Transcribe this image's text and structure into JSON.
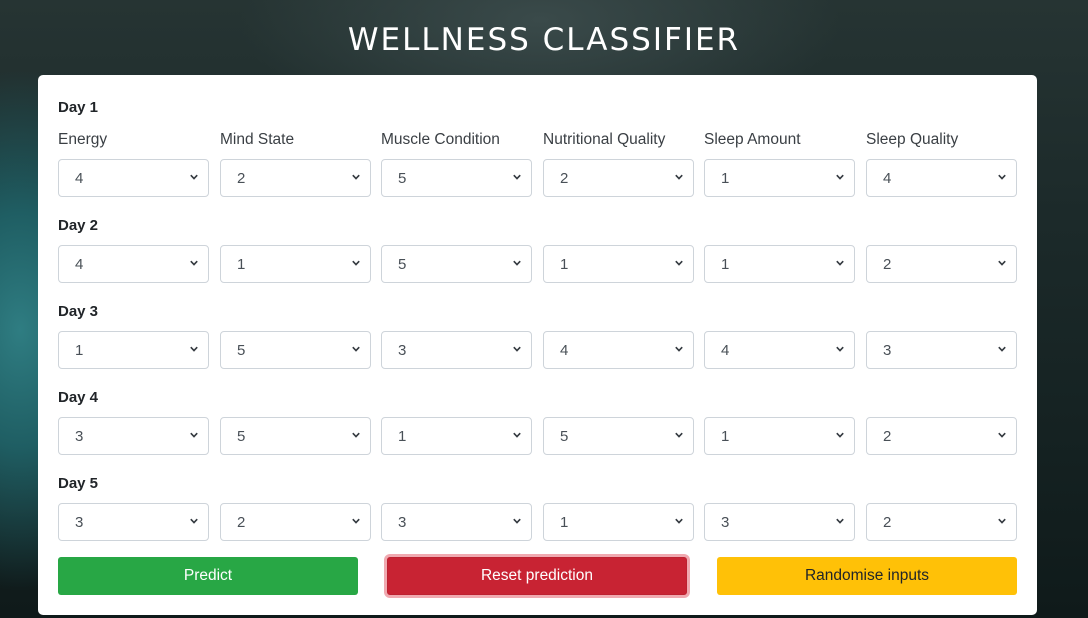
{
  "app": {
    "title": "WELLNESS CLASSIFIER"
  },
  "columns": [
    "Energy",
    "Mind State",
    "Muscle Condition",
    "Nutritional Quality",
    "Sleep Amount",
    "Sleep Quality"
  ],
  "days": [
    {
      "label": "Day 1",
      "values": [
        "4",
        "2",
        "5",
        "2",
        "1",
        "4"
      ]
    },
    {
      "label": "Day 2",
      "values": [
        "4",
        "1",
        "5",
        "1",
        "1",
        "2"
      ]
    },
    {
      "label": "Day 3",
      "values": [
        "1",
        "5",
        "3",
        "4",
        "4",
        "3"
      ]
    },
    {
      "label": "Day 4",
      "values": [
        "3",
        "5",
        "1",
        "5",
        "1",
        "2"
      ]
    },
    {
      "label": "Day 5",
      "values": [
        "3",
        "2",
        "3",
        "1",
        "3",
        "2"
      ]
    }
  ],
  "buttons": {
    "predict": "Predict",
    "reset": "Reset prediction",
    "randomise": "Randomise inputs"
  },
  "colors": {
    "predict": "#28a745",
    "reset": "#c82333",
    "randomise": "#ffc107"
  },
  "icons": {
    "dropdown": "chevron-down-icon"
  }
}
